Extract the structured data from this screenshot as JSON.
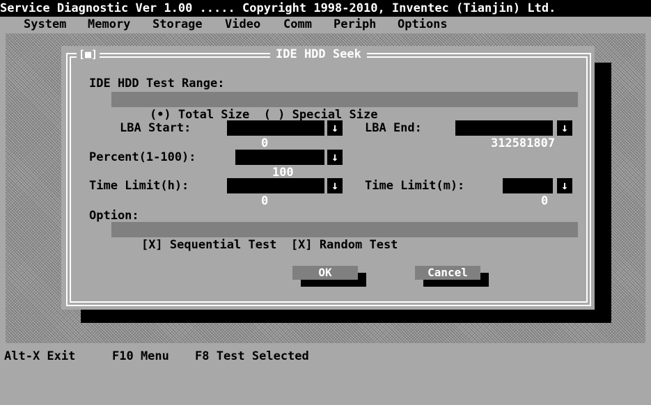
{
  "title_bar": "Service Diagnostic Ver 1.00 ..... Copyright 1998-2010, Inventec (Tianjin) Ltd.",
  "menu": {
    "system": "System",
    "memory": "Memory",
    "storage": "Storage",
    "video": "Video",
    "comm": "Comm",
    "periph": "Periph",
    "options": "Options"
  },
  "dialog": {
    "close_box": "[■]",
    "title": "IDE HDD Seek",
    "range_label": "IDE HDD Test Range:",
    "range_options": "(•) Total Size  ( ) Special Size",
    "lba_start_label": "LBA Start:",
    "lba_start_value": "0",
    "lba_end_label": "LBA End:",
    "lba_end_value": "312581807",
    "percent_label": "Percent(1-100):",
    "percent_value": "100",
    "time_h_label": "Time Limit(h):",
    "time_h_value": "0",
    "time_m_label": "Time Limit(m):",
    "time_m_value": "0",
    "option_label": "Option:",
    "option_values": "[X] Sequential Test  [X] Random Test",
    "ok_label": "OK",
    "cancel_label": "Cancel",
    "dropdown_glyph": "↓"
  },
  "status_bar": {
    "exit": "Alt-X Exit",
    "menu": "F10 Menu",
    "selected": "F8 Test Selected"
  },
  "colors": {
    "background": "#a8a8a8",
    "field": "#000000",
    "bar": "#808080",
    "hotkey": "#ffffff"
  }
}
